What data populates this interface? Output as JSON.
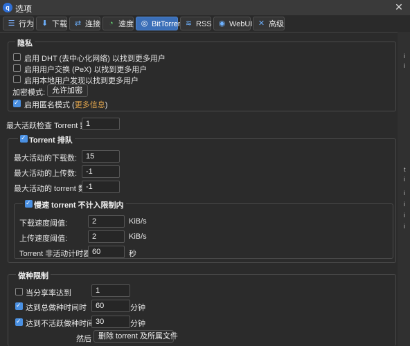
{
  "window": {
    "title": "选项",
    "close_glyph": "✕"
  },
  "tabs": [
    {
      "label": "行为",
      "icon": "list-icon"
    },
    {
      "label": "下载",
      "icon": "download-icon"
    },
    {
      "label": "连接",
      "icon": "connection-icon"
    },
    {
      "label": "速度",
      "icon": "speed-icon"
    },
    {
      "label": "BitTorrent",
      "icon": "bittorrent-icon",
      "active": true
    },
    {
      "label": "RSS",
      "icon": "rss-icon"
    },
    {
      "label": "WebUI",
      "icon": "webui-icon"
    },
    {
      "label": "高级",
      "icon": "tools-icon"
    }
  ],
  "privacy": {
    "legend": "隐私",
    "dht_label": "启用 DHT (去中心化网络) 以找到更多用户",
    "pex_label": "启用用户交换 (PeX) 以找到更多用户",
    "lsd_label": "启用本地用户发现以找到更多用户",
    "encryption_label": "加密模式:",
    "encryption_value": "允许加密",
    "anon_label": "启用匿名模式 (",
    "anon_link": "更多信息",
    "anon_close": ")",
    "dht_checked": false,
    "pex_checked": false,
    "lsd_checked": false,
    "anon_checked": true
  },
  "max_checking": {
    "label": "最大活跃检查 Torrent 数:",
    "value": "1"
  },
  "queueing": {
    "legend": "Torrent 排队",
    "checked": true,
    "max_downloads_label": "最大活动的下载数:",
    "max_downloads_value": "15",
    "max_uploads_label": "最大活动的上传数:",
    "max_uploads_value": "-1",
    "max_torrents_label": "最大活动的 torrent 数:",
    "max_torrents_value": "-1"
  },
  "slow_torrents": {
    "legend": "慢速 torrent 不计入限制内",
    "checked": true,
    "dl_label": "下载速度阈值:",
    "dl_value": "2",
    "dl_unit": "KiB/s",
    "ul_label": "上传速度阈值:",
    "ul_value": "2",
    "ul_unit": "KiB/s",
    "timer_label": "Torrent 非活动计时器:",
    "timer_value": "60",
    "timer_unit": "秒"
  },
  "seeding": {
    "legend": "做种限制",
    "ratio_label": "当分享率达到",
    "ratio_value": "1",
    "ratio_checked": false,
    "time_label": "达到总做种时间时",
    "time_value": "60",
    "time_unit": "分钟",
    "time_checked": true,
    "inactive_label": "达到不活跃做种时间时",
    "inactive_value": "30",
    "inactive_unit": "分钟",
    "inactive_checked": true,
    "then_label": "然后",
    "then_value": "删除 torrent 及所属文件"
  },
  "scroll_ticks": [
    "i",
    "i",
    "t",
    "i",
    "i",
    "i",
    "i",
    "i"
  ]
}
